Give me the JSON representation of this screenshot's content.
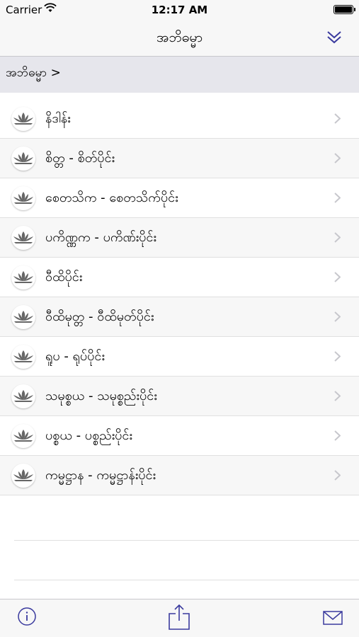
{
  "status_bar": {
    "carrier": "Carrier",
    "time": "12:17 AM"
  },
  "nav": {
    "title": "အဘိဓမ္မာ"
  },
  "breadcrumb": {
    "text": "အဘိဓမ္မာ >"
  },
  "list": {
    "items": [
      {
        "label": "နိဒါန်း"
      },
      {
        "label": "စိတ္တ - စိတ်ပိုင်း"
      },
      {
        "label": "စေတသိက - စေတသိက်ပိုင်း"
      },
      {
        "label": "ပကိဏ္ဏက - ပကိဏ်းပိုင်း"
      },
      {
        "label": "ဝီထိပိုင်း"
      },
      {
        "label": "ဝီထိမုတ္တ - ဝီထိမုတ်ပိုင်း"
      },
      {
        "label": "ရူပ - ရုပ်ပိုင်း"
      },
      {
        "label": "သမုစ္စယ - သမုစ္စည်းပိုင်း"
      },
      {
        "label": "ပစ္စယ - ပစ္စည်းပိုင်း"
      },
      {
        "label": "ကမ္မဋ္ဌာန - ကမ္မဋ္ဌာန်းပိုင်း"
      }
    ]
  },
  "icons": {
    "row_icon": "lotus-icon",
    "nav_right": "double-chevron-down-icon",
    "toolbar": [
      "info-icon",
      "share-icon",
      "mail-icon"
    ]
  },
  "colors": {
    "accent": "#3a3a9e",
    "chevron": "#c7c7cc"
  }
}
